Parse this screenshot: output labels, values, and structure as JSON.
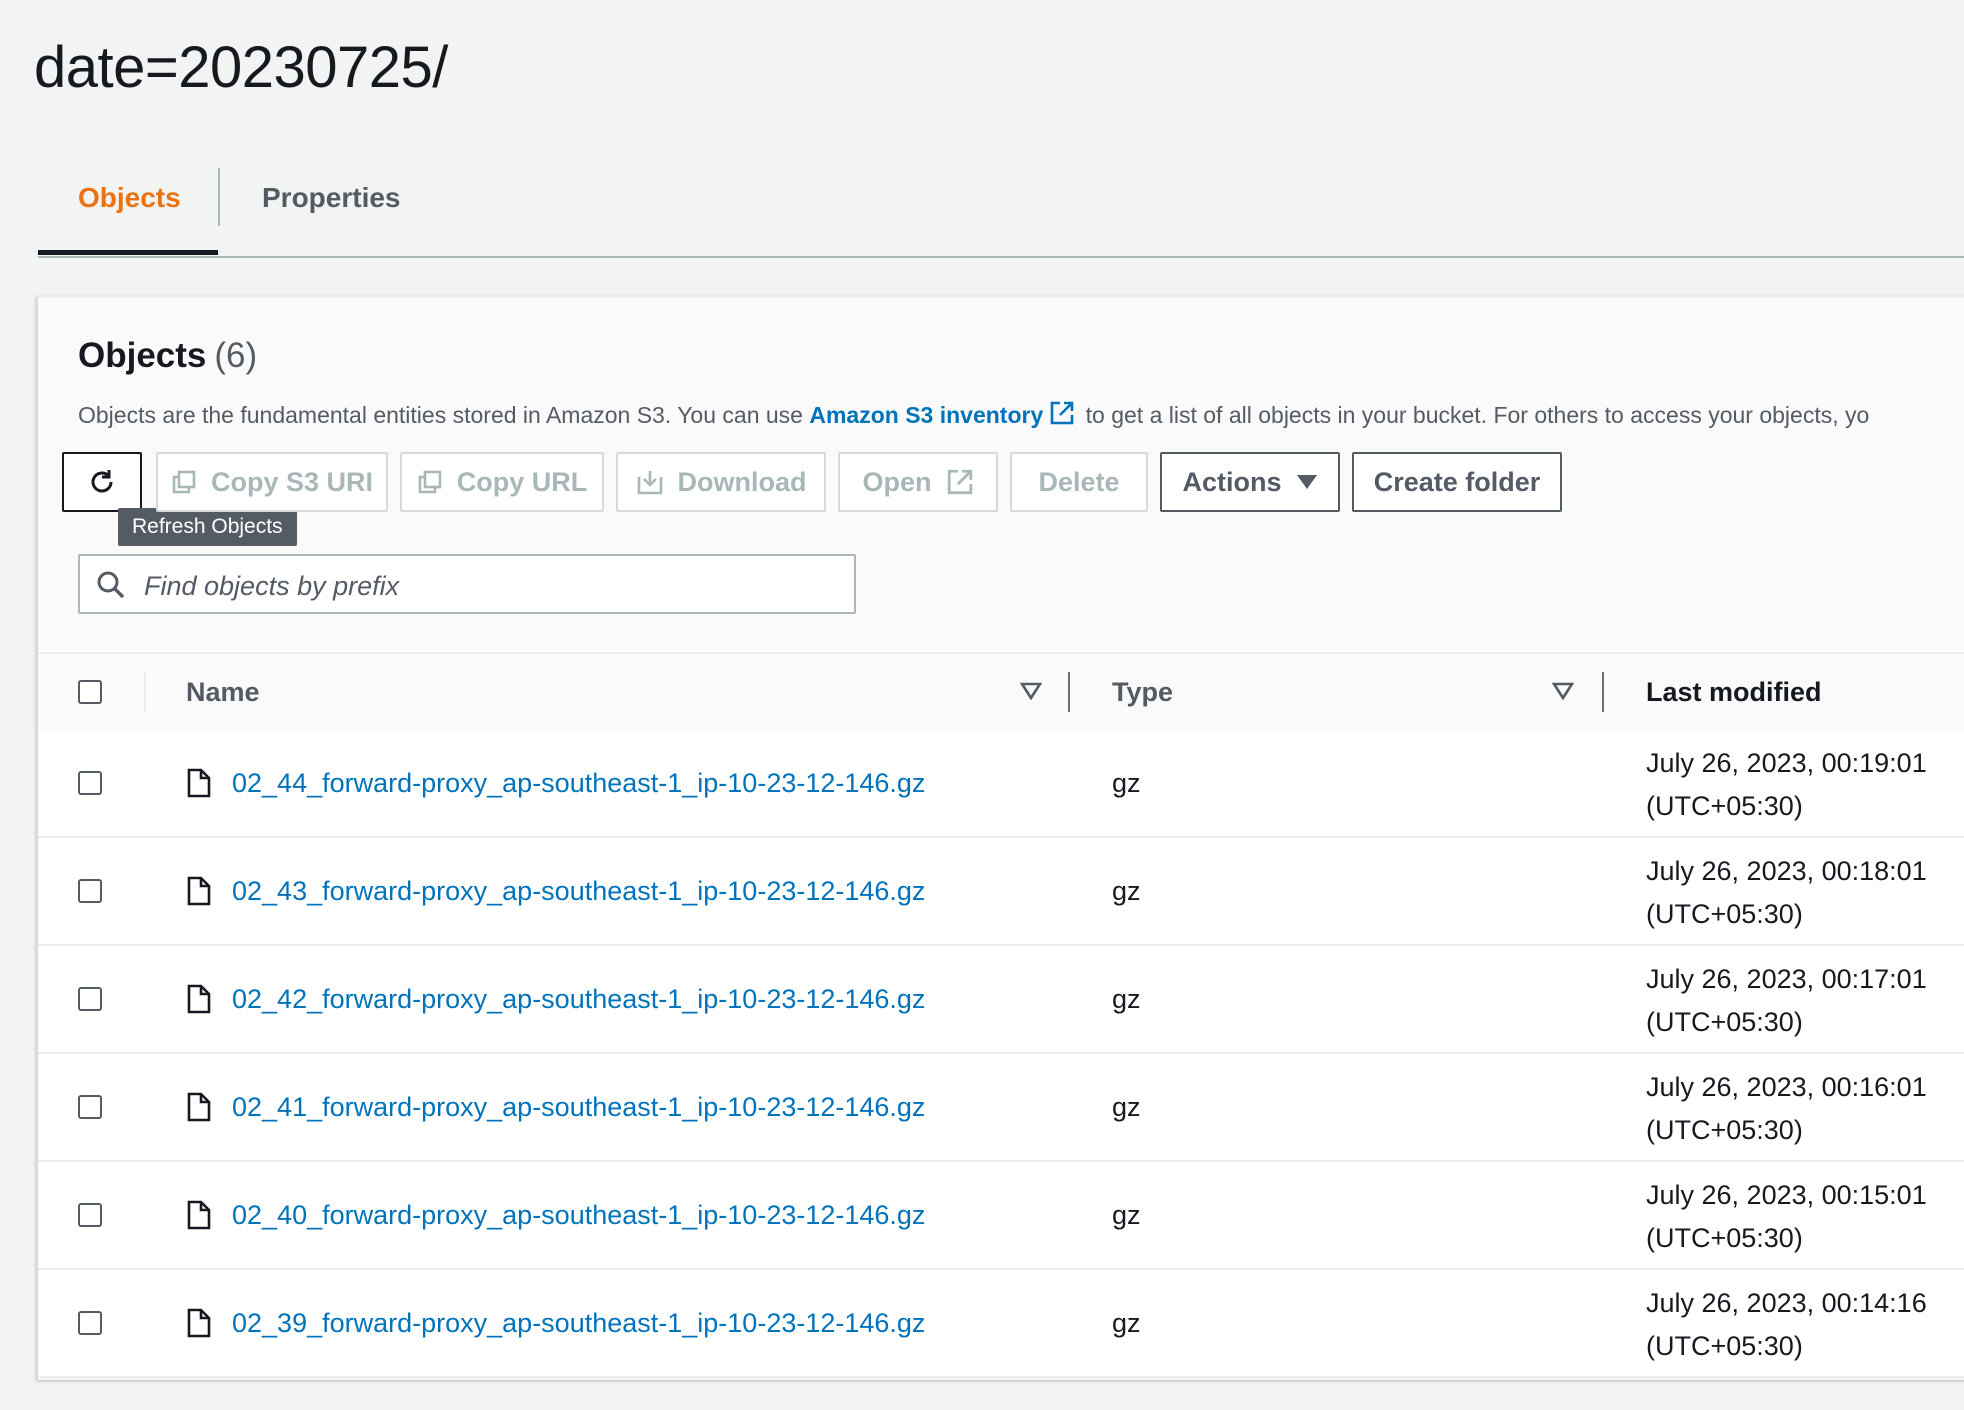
{
  "page": {
    "title": "date=20230725/"
  },
  "tabs": [
    {
      "label": "Objects",
      "active": true
    },
    {
      "label": "Properties",
      "active": false
    }
  ],
  "objects_panel": {
    "title": "Objects",
    "count": "(6)",
    "description_pre": "Objects are the fundamental entities stored in Amazon S3. You can use",
    "inventory_link": "Amazon S3 inventory",
    "description_post": "to get a list of all objects in your bucket. For others to access your objects, yo"
  },
  "toolbar": {
    "refresh_tooltip": "Refresh Objects",
    "copy_s3_uri": "Copy S3 URI",
    "copy_url": "Copy URL",
    "download": "Download",
    "open": "Open",
    "delete": "Delete",
    "actions": "Actions",
    "create_folder": "Create folder"
  },
  "search": {
    "placeholder": "Find objects by prefix",
    "value": ""
  },
  "table": {
    "columns": {
      "name": "Name",
      "type": "Type",
      "last_modified": "Last modified"
    },
    "rows": [
      {
        "name": "02_44_forward-proxy_ap-southeast-1_ip-10-23-12-146.gz",
        "type": "gz",
        "date": "July 26, 2023, 00:19:01",
        "tz": "(UTC+05:30)"
      },
      {
        "name": "02_43_forward-proxy_ap-southeast-1_ip-10-23-12-146.gz",
        "type": "gz",
        "date": "July 26, 2023, 00:18:01",
        "tz": "(UTC+05:30)"
      },
      {
        "name": "02_42_forward-proxy_ap-southeast-1_ip-10-23-12-146.gz",
        "type": "gz",
        "date": "July 26, 2023, 00:17:01",
        "tz": "(UTC+05:30)"
      },
      {
        "name": "02_41_forward-proxy_ap-southeast-1_ip-10-23-12-146.gz",
        "type": "gz",
        "date": "July 26, 2023, 00:16:01",
        "tz": "(UTC+05:30)"
      },
      {
        "name": "02_40_forward-proxy_ap-southeast-1_ip-10-23-12-146.gz",
        "type": "gz",
        "date": "July 26, 2023, 00:15:01",
        "tz": "(UTC+05:30)"
      },
      {
        "name": "02_39_forward-proxy_ap-southeast-1_ip-10-23-12-146.gz",
        "type": "gz",
        "date": "July 26, 2023, 00:14:16",
        "tz": "(UTC+05:30)"
      }
    ]
  },
  "colors": {
    "accent": "#ec7211",
    "link": "#0073bb",
    "text": "#16191f",
    "muted": "#545b64",
    "disabled": "#aab7b8"
  }
}
